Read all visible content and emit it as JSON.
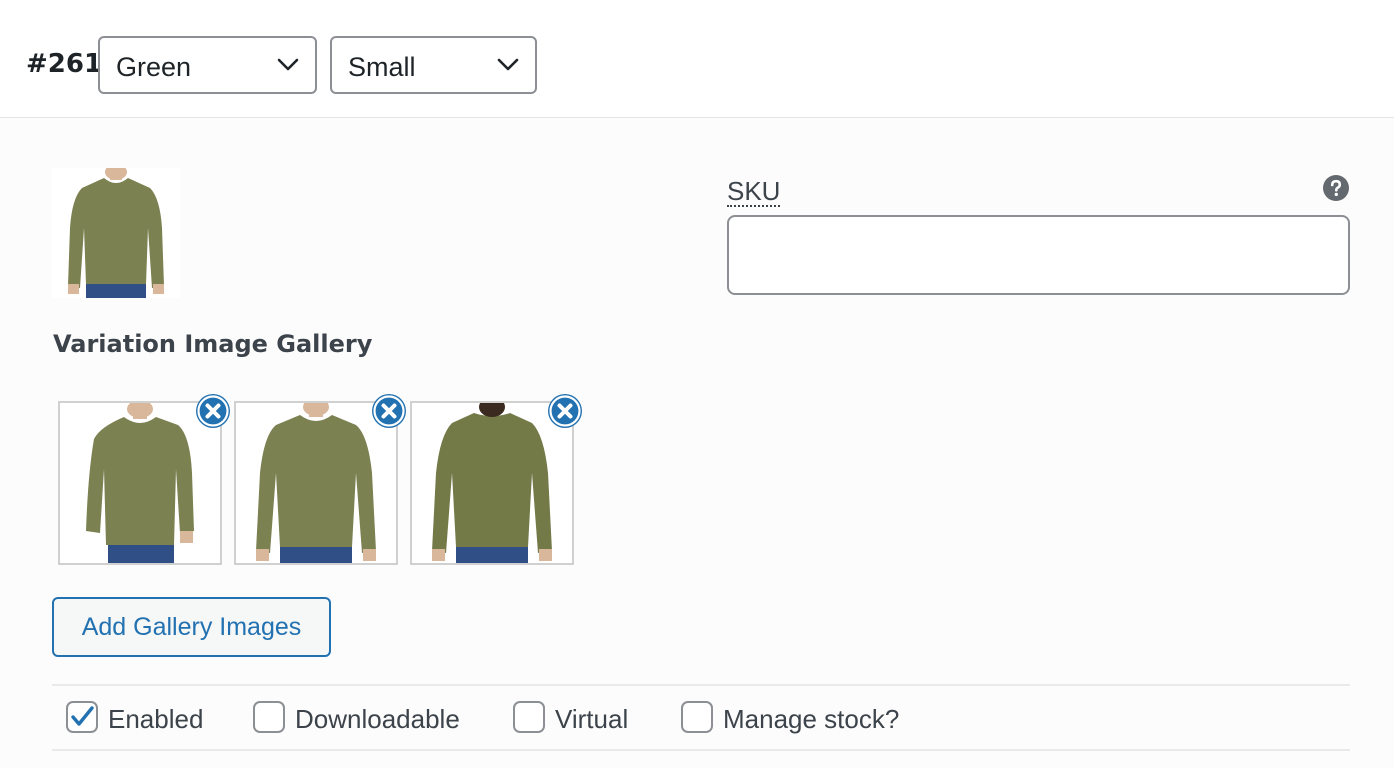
{
  "variation": {
    "id_label": "#261",
    "color_select": {
      "value": "Green"
    },
    "size_select": {
      "value": "Small"
    }
  },
  "sku": {
    "label": "SKU",
    "value": "",
    "help_icon": "question-circle-icon"
  },
  "gallery": {
    "title": "Variation Image Gallery",
    "images": [
      {
        "alt": "green long sleeve shirt front angled",
        "remove_icon": "remove-circle-icon"
      },
      {
        "alt": "green long sleeve shirt front",
        "remove_icon": "remove-circle-icon"
      },
      {
        "alt": "green long sleeve shirt back",
        "remove_icon": "remove-circle-icon"
      }
    ],
    "add_button_label": "Add Gallery Images"
  },
  "options": [
    {
      "label": "Enabled",
      "checked": true
    },
    {
      "label": "Downloadable",
      "checked": false
    },
    {
      "label": "Virtual",
      "checked": false
    },
    {
      "label": "Manage stock?",
      "checked": false
    }
  ],
  "colors": {
    "accent": "#2271b1",
    "border": "#8c8f94",
    "shirt": "#7b8150",
    "jeans": "#2f4f86"
  }
}
